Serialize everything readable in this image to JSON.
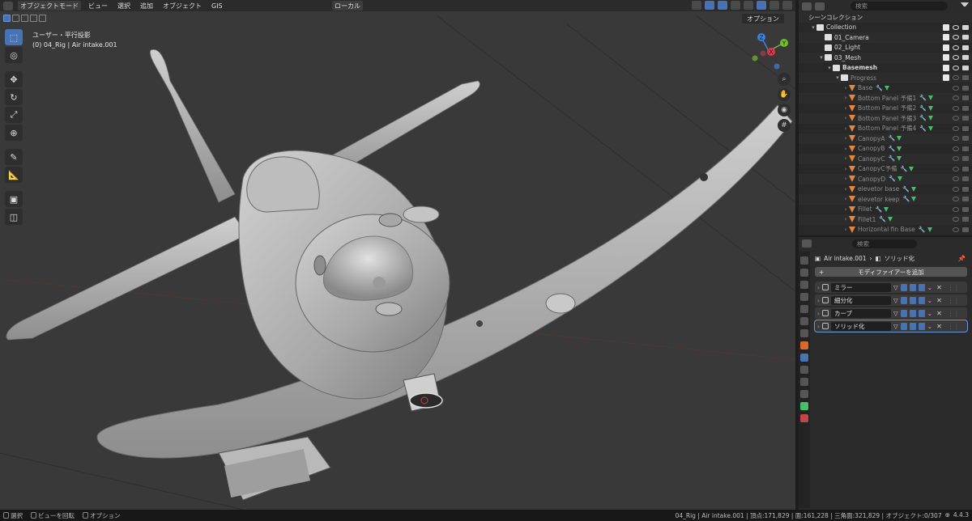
{
  "viewport": {
    "header": {
      "mode": "オブジェクトモード",
      "menus": [
        "ビュー",
        "選択",
        "追加",
        "オブジェクト",
        "GIS"
      ],
      "transform_orientation": "ローカル"
    },
    "options_label": "オプション",
    "info_line1": "ユーザー・平行投影",
    "info_line2": "(0) 04_Rig | Air intake.001",
    "gizmo": {
      "z": "Z",
      "y": "Y",
      "x": "X"
    },
    "tool_icons": [
      "select-box-icon",
      "cursor-icon",
      "move-icon",
      "rotate-icon",
      "scale-icon",
      "transform-icon",
      "annotate-icon",
      "measure-icon",
      "add-cube-icon",
      "add-cylinder-icon"
    ]
  },
  "outliner": {
    "search_placeholder": "検索",
    "items": [
      {
        "label": "シーンコレクション",
        "depth": 0,
        "kind": "scene"
      },
      {
        "label": "Collection",
        "depth": 1,
        "kind": "collection",
        "twirl": "▾"
      },
      {
        "label": "01_Camera",
        "depth": 2,
        "kind": "collection"
      },
      {
        "label": "02_Light",
        "depth": 2,
        "kind": "collection"
      },
      {
        "label": "03_Mesh",
        "depth": 2,
        "kind": "collection",
        "twirl": "▾"
      },
      {
        "label": "Basemesh",
        "depth": 3,
        "kind": "collection",
        "twirl": "▾",
        "bold": true
      },
      {
        "label": "Progress",
        "depth": 4,
        "kind": "collection",
        "twirl": "▾",
        "dim": true
      },
      {
        "label": "Base",
        "depth": 5,
        "kind": "mesh",
        "dim": true
      },
      {
        "label": "Bottom Panel 予備1",
        "depth": 5,
        "kind": "mesh",
        "dim": true
      },
      {
        "label": "Bottom Panel 予備2",
        "depth": 5,
        "kind": "mesh",
        "dim": true
      },
      {
        "label": "Bottom Panel 予備3",
        "depth": 5,
        "kind": "mesh",
        "dim": true
      },
      {
        "label": "Bottom Panel 予備4",
        "depth": 5,
        "kind": "mesh",
        "dim": true
      },
      {
        "label": "CanopyA",
        "depth": 5,
        "kind": "mesh",
        "dim": true
      },
      {
        "label": "CanopyB",
        "depth": 5,
        "kind": "mesh",
        "dim": true
      },
      {
        "label": "CanopyC",
        "depth": 5,
        "kind": "mesh",
        "dim": true
      },
      {
        "label": "CanopyC予備",
        "depth": 5,
        "kind": "mesh",
        "dim": true
      },
      {
        "label": "CanopyD",
        "depth": 5,
        "kind": "mesh",
        "dim": true
      },
      {
        "label": "elevetor base",
        "depth": 5,
        "kind": "mesh",
        "dim": true
      },
      {
        "label": "elevetor keep",
        "depth": 5,
        "kind": "mesh",
        "dim": true
      },
      {
        "label": "Fillet",
        "depth": 5,
        "kind": "mesh",
        "dim": true
      },
      {
        "label": "Fillet1",
        "depth": 5,
        "kind": "mesh",
        "dim": true
      },
      {
        "label": "Horizontal fin Base",
        "depth": 5,
        "kind": "mesh",
        "dim": true
      }
    ]
  },
  "properties": {
    "search_placeholder": "検索",
    "breadcrumb_object": "Air intake.001",
    "breadcrumb_modifier": "ソリッド化",
    "add_modifier_label": "モディファイアーを追加",
    "modifiers": [
      {
        "name": "ミラー",
        "icon": "mirror-icon"
      },
      {
        "name": "細分化",
        "icon": "subdivision-icon"
      },
      {
        "name": "カーブ",
        "icon": "curve-icon"
      },
      {
        "name": "ソリッド化",
        "icon": "solidify-icon",
        "active": true
      }
    ]
  },
  "statusbar": {
    "select_label": "選択",
    "rotate_label": "ビューを回転",
    "options_label": "オプション",
    "stats": "04_Rig | Air intake.001 | 頂点:171,829 | 面:161,228 | 三角面:321,829 | オブジェクト:0/307",
    "version": "4.4.3"
  },
  "colors": {
    "accent": "#4772b3",
    "viewport_bg": "#393939",
    "mesh_orange": "#e8863b",
    "axis_x": "#e0374a",
    "axis_y": "#6fbf2b",
    "axis_z": "#3b82e0"
  }
}
